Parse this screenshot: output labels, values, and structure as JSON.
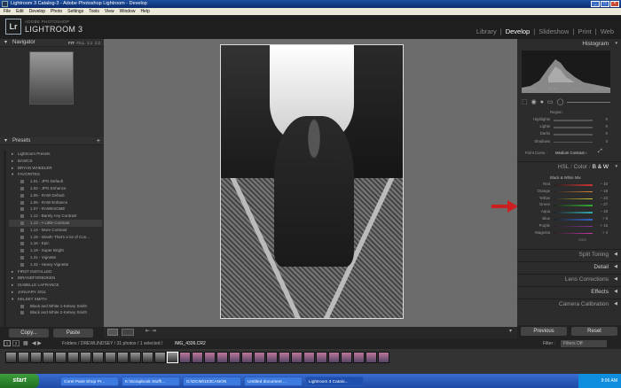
{
  "window": {
    "title": "Lightroom 3 Catalog-3 - Adobe Photoshop Lightroom - Develop"
  },
  "menu": [
    "File",
    "Edit",
    "Develop",
    "Photo",
    "Settings",
    "Tools",
    "View",
    "Window",
    "Help"
  ],
  "brand": {
    "badge": "Lr",
    "line1": "ADOBE PHOTOSHOP",
    "line2": "LIGHTROOM 3"
  },
  "modules": [
    {
      "label": "Library",
      "active": false
    },
    {
      "label": "Develop",
      "active": true
    },
    {
      "label": "Slideshow",
      "active": false
    },
    {
      "label": "Print",
      "active": false
    },
    {
      "label": "Web",
      "active": false
    }
  ],
  "navigator": {
    "label": "Navigator",
    "zoom": [
      "FIT",
      "FILL",
      "1:1",
      "1:2"
    ]
  },
  "presets": {
    "label": "Presets",
    "items": [
      {
        "type": "folder",
        "label": "Lightroom Presets"
      },
      {
        "type": "folder",
        "label": "BASICS"
      },
      {
        "type": "folder",
        "label": "BRYAN WHEELER"
      },
      {
        "type": "folder-open",
        "label": "FAVORITES"
      },
      {
        "type": "preset",
        "label": "1.01 - JPG Default"
      },
      {
        "type": "preset",
        "label": "1.02 - JPG Enhance"
      },
      {
        "type": "preset",
        "label": "1.05 - RAW Default"
      },
      {
        "type": "preset",
        "label": "1.06 - RAW Enhance"
      },
      {
        "type": "preset",
        "label": "1.07 - RAWESOME"
      },
      {
        "type": "preset",
        "label": "1.12 - Barely Any Contrast"
      },
      {
        "type": "preset",
        "label": "1.13 - A Little Contrast"
      },
      {
        "type": "preset",
        "label": "1.14 - More Contrast"
      },
      {
        "type": "preset",
        "label": "1.15 - Woah! That's a lot of Con..."
      },
      {
        "type": "preset",
        "label": "1.16 - Epic"
      },
      {
        "type": "preset",
        "label": "1.19 - Super Bright"
      },
      {
        "type": "preset",
        "label": "1.31 - Vignette"
      },
      {
        "type": "preset",
        "label": "1.32 - Heavy Vignette"
      },
      {
        "type": "folder",
        "label": "FIRST INSTALLED"
      },
      {
        "type": "folder",
        "label": "IBRANDFORBOKEN"
      },
      {
        "type": "folder",
        "label": "ISABELLE LAFRANCE"
      },
      {
        "type": "folder",
        "label": "JANUARY 2011"
      },
      {
        "type": "folder-open",
        "label": "KELSEY SMITH"
      },
      {
        "type": "preset",
        "label": "Black and White 1-Kelsey Smith"
      },
      {
        "type": "preset",
        "label": "Black and White 2-Kelsey Smith"
      }
    ]
  },
  "left_buttons": {
    "copy": "Copy...",
    "paste": "Paste"
  },
  "right": {
    "histogram_label": "Histogram",
    "histogram_meta": [
      "ISO 400",
      "35 mm",
      "f / 2.0",
      "1/200 sec"
    ],
    "region_label": "Region",
    "tone_rows": [
      {
        "label": "Highlights",
        "value": "0"
      },
      {
        "label": "Lights",
        "value": "0"
      },
      {
        "label": "Darks",
        "value": "0"
      },
      {
        "label": "Shadows",
        "value": "0"
      }
    ],
    "point_curve_label": "Point Curve :",
    "point_curve_value": "Medium Contrast ↕",
    "tabs": [
      "HSL",
      "Color",
      "B & W"
    ],
    "bw_title": "Black & White Mix",
    "bw_rows": [
      {
        "label": "Red",
        "value": "− 10",
        "color": "#c33"
      },
      {
        "label": "Orange",
        "value": "− 19",
        "color": "#d83"
      },
      {
        "label": "Yellow",
        "value": "− 23",
        "color": "#cc3"
      },
      {
        "label": "Green",
        "value": "− 27",
        "color": "#3a3"
      },
      {
        "label": "Aqua",
        "value": "− 18",
        "color": "#3aa"
      },
      {
        "label": "Blue",
        "value": "+ 9",
        "color": "#36c"
      },
      {
        "label": "Purple",
        "value": "+ 15",
        "color": "#839"
      },
      {
        "label": "Magenta",
        "value": "+ 4",
        "color": "#c3a"
      }
    ],
    "auto_label": "Auto",
    "sections": [
      {
        "label": "Split Toning",
        "bright": false
      },
      {
        "label": "Detail",
        "bright": true
      },
      {
        "label": "Lens Corrections",
        "bright": false
      },
      {
        "label": "Effects",
        "bright": true
      },
      {
        "label": "Camera Calibration",
        "bright": false
      }
    ],
    "previous": "Previous",
    "reset": "Reset"
  },
  "filmbar": {
    "page1": "1",
    "page2": "2",
    "path": "Folders / DREWLINDSEY / 31 photos / 1 selected /",
    "filename": "IMG_4336.CR2",
    "filter_label": "Filter :",
    "filter_value": "Filters Off"
  },
  "taskbar": {
    "start": "start",
    "tasks": [
      "Corel Paint Shop Pr...",
      "K:\\Scrapbook Stuff\\...",
      "G:\\DCIM\\103CANON",
      "Untitled document ...",
      "Lightroom 3 Catalo..."
    ],
    "time": "9:06 AM"
  },
  "colors": {
    "accent_arrow": "#cc1f1f"
  }
}
